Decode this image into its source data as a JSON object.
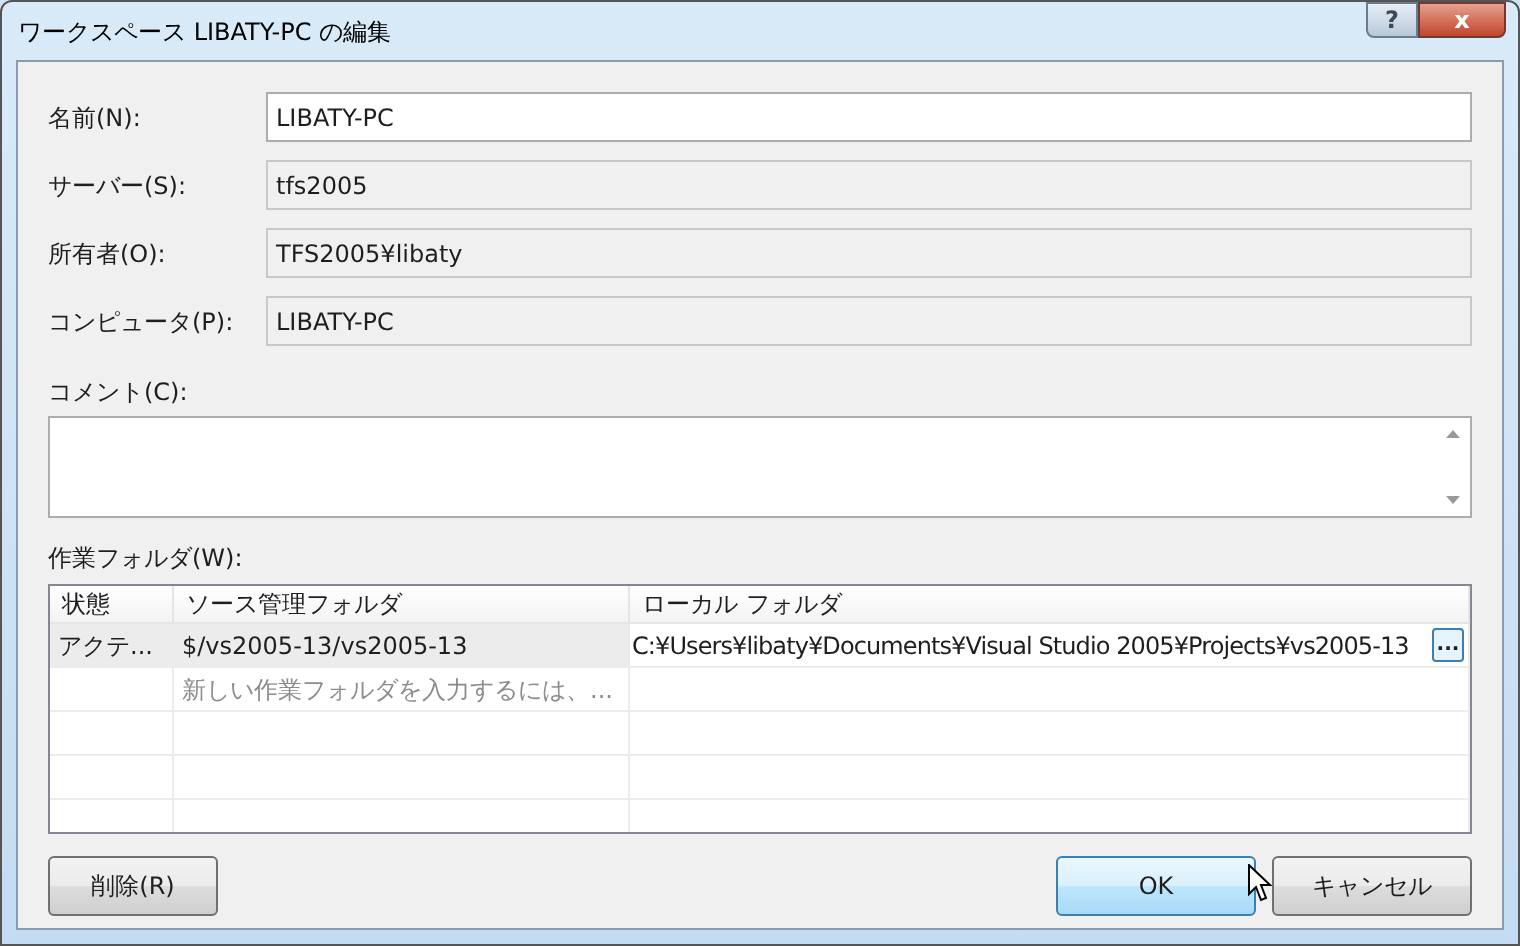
{
  "window": {
    "title": "ワークスペース LIBATY-PC の編集",
    "controls": [
      "?",
      "x"
    ]
  },
  "fields": [
    {
      "label": "名前(N):",
      "value": "LIBATY-PC",
      "kind": "editable"
    },
    {
      "label": "サーバー(S):",
      "value": "tfs2005",
      "kind": "readonly"
    },
    {
      "label": "所有者(O):",
      "value": "TFS2005¥libaty",
      "kind": "readonly"
    },
    {
      "label": "コンピュータ(P):",
      "value": "LIBATY-PC",
      "kind": "readonly"
    }
  ],
  "comment": {
    "label": "コメント(C):"
  },
  "working_folders": {
    "label": "作業フォルダ(W):",
    "columns": [
      "状態",
      "ソース管理フォルダ",
      "ローカル フォルダ"
    ],
    "rows": [
      {
        "kind": "mapping",
        "status": "アクテ...",
        "source": "$/vs2005-13/vs2005-13",
        "local": "C:¥Users¥libaty¥Documents¥Visual Studio 2005¥Projects¥vs2005-13",
        "browse": "...",
        "selected": true
      },
      {
        "kind": "new",
        "placeholder": "新しい作業フォルダを入力するには、..."
      }
    ]
  },
  "buttons": [
    {
      "label": "削除(R)",
      "default": false
    },
    {
      "label": "OK",
      "default": true
    },
    {
      "label": "キャンセル",
      "default": false
    }
  ]
}
